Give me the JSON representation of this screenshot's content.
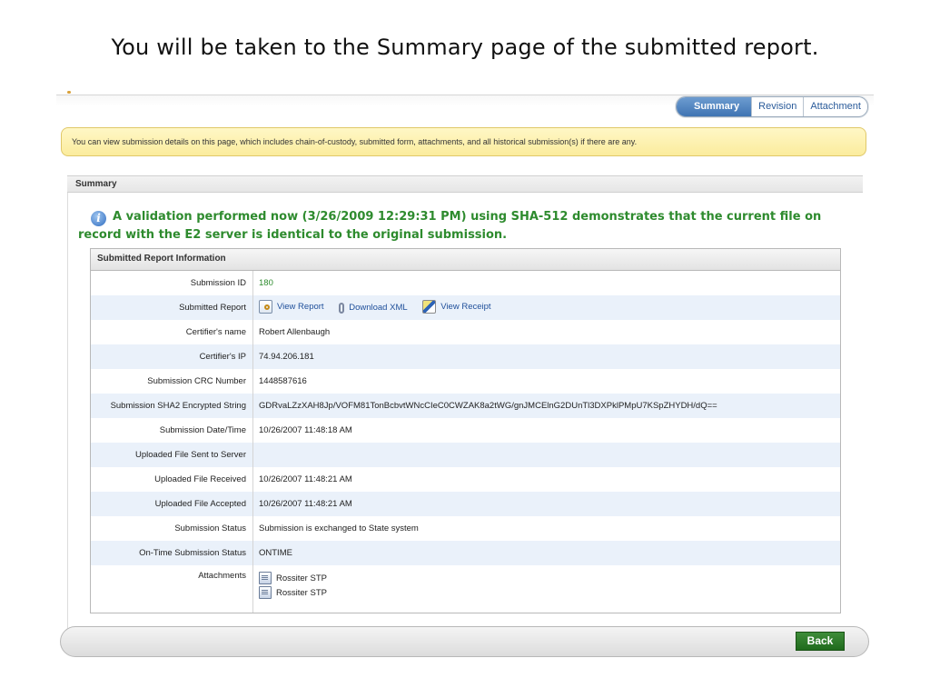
{
  "caption": "You will be taken to the Summary page of the submitted report.",
  "tabs": [
    {
      "label": "Summary",
      "active": true
    },
    {
      "label": "Revision",
      "active": false
    },
    {
      "label": "Attachment",
      "active": false
    }
  ],
  "notice": "You can view submission details on this page, which includes chain-of-custody, submitted form, attachments, and all historical submission(s) if there are any.",
  "panel": {
    "title": "Summary",
    "validation": "A validation performed now (3/26/2009 12:29:31 PM) using SHA-512 demonstrates that the current file on record with the E2 server is identical to the original submission."
  },
  "report": {
    "title": "Submitted Report Information",
    "rows": [
      {
        "label": "Submission ID",
        "value": "180"
      },
      {
        "label": "Submitted Report",
        "links": [
          "View Report",
          "Download XML",
          "View Receipt"
        ]
      },
      {
        "label": "Certifier's name",
        "value": "Robert Allenbaugh"
      },
      {
        "label": "Certifier's IP",
        "value": "74.94.206.181"
      },
      {
        "label": "Submission CRC Number",
        "value": "1448587616"
      },
      {
        "label": "Submission SHA2 Encrypted String",
        "value": "GDRvaLZzXAH8Jp/VOFM81TonBcbvtWNcCIeC0CWZAK8a2tWG/gnJMCElnG2DUnTl3DXPklPMpU7KSpZHYDH/dQ=="
      },
      {
        "label": "Submission Date/Time",
        "value": "10/26/2007 11:48:18 AM"
      },
      {
        "label": "Uploaded File Sent to Server",
        "value": ""
      },
      {
        "label": "Uploaded File Received",
        "value": "10/26/2007 11:48:21 AM"
      },
      {
        "label": "Uploaded File Accepted",
        "value": "10/26/2007 11:48:21 AM"
      },
      {
        "label": "Submission Status",
        "value": "Submission is exchanged to State system"
      },
      {
        "label": "On-Time Submission Status",
        "value": "ONTIME"
      },
      {
        "label": "Attachments",
        "attachments": [
          "Rossiter STP",
          "Rossiter STP"
        ]
      }
    ]
  },
  "buttons": {
    "back": "Back"
  },
  "colors": {
    "accent": "#3f74b3",
    "success": "#2e8b2e",
    "notice_bg": "#fbec9d",
    "back_button": "#2a7a25"
  }
}
